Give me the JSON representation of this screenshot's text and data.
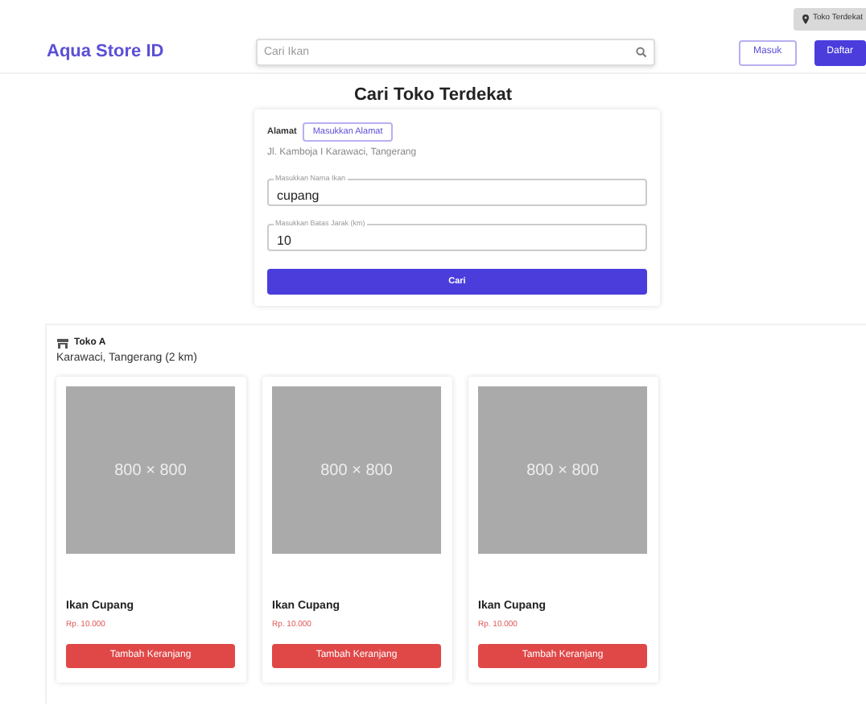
{
  "top_badge": "Toko Terdekat",
  "header": {
    "logo": "Aqua Store ID",
    "search": {
      "placeholder": "Cari Ikan"
    },
    "buttons": [
      {
        "label": "Masuk",
        "kind": "outline"
      },
      {
        "label": "Daftar",
        "kind": "solid"
      }
    ]
  },
  "title": "Cari Toko Terdekat",
  "form": {
    "address_label": "Alamat",
    "address_button": "Masukkan Alamat",
    "address": "Jl. Kamboja I Karawaci, Tangerang",
    "fields": [
      {
        "label": "Masukkan Nama Ikan",
        "value": "cupang"
      },
      {
        "label": "Masukkan Batas Jarak (km)",
        "value": "10"
      }
    ],
    "submit": "Cari"
  },
  "store": {
    "name": "Toko A",
    "location": "Karawaci, Tangerang (2 km)",
    "products": [
      {
        "image_text": "800 × 800",
        "name": "Ikan Cupang",
        "price": "Rp. 10.000",
        "button": "Tambah Keranjang"
      },
      {
        "image_text": "800 × 800",
        "name": "Ikan Cupang",
        "price": "Rp. 10.000",
        "button": "Tambah Keranjang"
      },
      {
        "image_text": "800 × 800",
        "name": "Ikan Cupang",
        "price": "Rp. 10.000",
        "button": "Tambah Keranjang"
      }
    ]
  }
}
